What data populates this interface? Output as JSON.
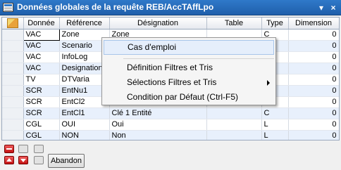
{
  "window": {
    "title": "Données globales de la requête REB/AccTAffLpo",
    "pin_glyph": "▾ ╤",
    "close_glyph": "×"
  },
  "grid": {
    "columns": [
      "Donnée",
      "Référence",
      "Désignation",
      "Table",
      "Type",
      "Dimension"
    ],
    "rows": [
      {
        "donnee": "VAC",
        "reference": "Zone",
        "designation": "Zone",
        "table": "",
        "type": "C",
        "dimension": "0"
      },
      {
        "donnee": "VAC",
        "reference": "Scenario",
        "designation": "",
        "table": "",
        "type": "",
        "dimension": "0"
      },
      {
        "donnee": "VAC",
        "reference": "InfoLog",
        "designation": "",
        "table": "",
        "type": "",
        "dimension": "0"
      },
      {
        "donnee": "VAC",
        "reference": "Designation",
        "designation": "",
        "table": "",
        "type": "",
        "dimension": "0"
      },
      {
        "donnee": "TV",
        "reference": "DTVaria",
        "designation": "",
        "table": "",
        "type": "",
        "dimension": "0"
      },
      {
        "donnee": "SCR",
        "reference": "EntNu1",
        "designation": "",
        "table": "",
        "type": "",
        "dimension": "0"
      },
      {
        "donnee": "SCR",
        "reference": "EntCl2",
        "designation": "",
        "table": "",
        "type": "",
        "dimension": "0"
      },
      {
        "donnee": "SCR",
        "reference": "EntCl1",
        "designation": "Clé 1 Entité",
        "table": "",
        "type": "C",
        "dimension": "0"
      },
      {
        "donnee": "CGL",
        "reference": "OUI",
        "designation": "Oui",
        "table": "",
        "type": "L",
        "dimension": "0"
      },
      {
        "donnee": "CGL",
        "reference": "NON",
        "designation": "Non",
        "table": "",
        "type": "L",
        "dimension": "0"
      }
    ]
  },
  "context_menu": {
    "items": [
      {
        "label": "Cas d'emploi",
        "highlighted": true
      },
      {
        "label": "Définition Filtres et Tris"
      },
      {
        "label": "Sélections Filtres et Tris",
        "submenu": true
      },
      {
        "label": "Condition par Défaut (Ctrl-F5)"
      }
    ]
  },
  "toolbar": {
    "abandon_label": "Abandon"
  },
  "colors": {
    "titlebar": "#2f79c9",
    "row_alt": "#e8f0fc",
    "menu_highlight": "#e5eefb",
    "nav_red": "#c41212"
  },
  "icons": {
    "window": "grid-window-icon",
    "pin": "pin-icon",
    "close": "close-icon",
    "corner": "row-header-corner-icon"
  }
}
